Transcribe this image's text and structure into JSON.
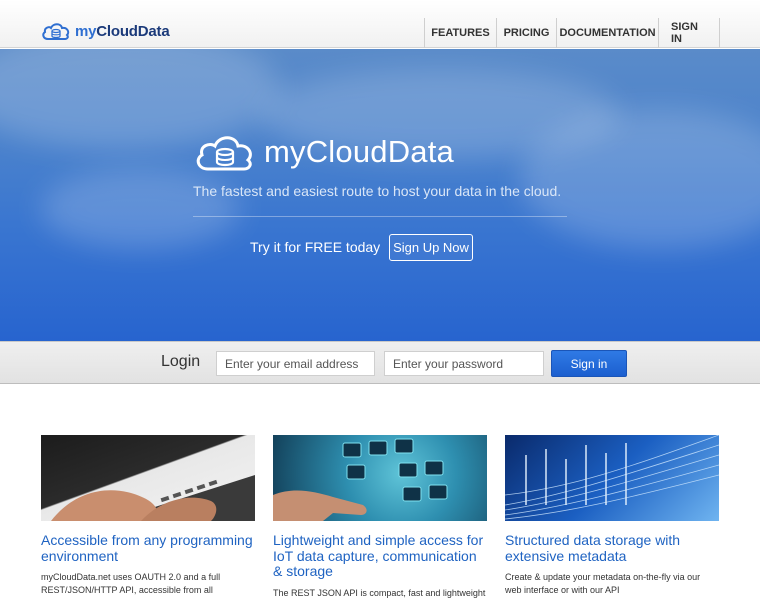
{
  "header": {
    "brand_prefix": "my",
    "brand_name": "CloudData",
    "nav": [
      {
        "label": "FEATURES"
      },
      {
        "label": "PRICING"
      },
      {
        "label": "DOCUMENTATION"
      },
      {
        "label": "SIGN IN"
      }
    ]
  },
  "hero": {
    "title": "myCloudData",
    "tagline": "The fastest and easiest route to host your data in the cloud.",
    "try_text": "Try it for FREE today",
    "signup_label": "Sign Up Now"
  },
  "login": {
    "label": "Login",
    "email_placeholder": "Enter your email address",
    "password_placeholder": "Enter your password",
    "signin_label": "Sign in"
  },
  "features": [
    {
      "title": "Accessible from any programming environment",
      "desc": "myCloudData.net uses OAUTH 2.0 and a full REST/JSON/HTTP API, accessible from all"
    },
    {
      "title": "Lightweight and simple access for IoT data capture, communication & storage",
      "desc": "The REST JSON API is compact, fast and lightweight"
    },
    {
      "title": "Structured data storage with extensive metadata",
      "desc": "Create & update your metadata on-the-fly via our web interface or with our API"
    }
  ],
  "colors": {
    "accent": "#1f63c2",
    "hero_top": "#5a8bc9",
    "hero_bottom": "#2764cf",
    "signin_button": "#2f7ae5"
  }
}
